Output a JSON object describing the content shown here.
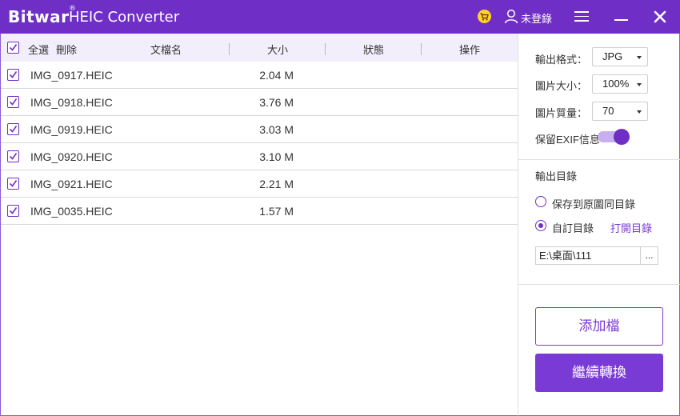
{
  "titlebar": {
    "logo": "Bitwar",
    "logo_mark": "®",
    "title": "HEIC Converter",
    "login_label": "未登錄",
    "icons": [
      "cart-icon",
      "user-icon",
      "menu-icon",
      "minimize-icon",
      "close-icon"
    ]
  },
  "table": {
    "select_all": "全選",
    "delete": "刪除",
    "headers": {
      "filename": "文檔名",
      "size": "大小",
      "status": "狀態",
      "action": "操作"
    },
    "rows": [
      {
        "name": "IMG_0917.HEIC",
        "size": "2.04 M",
        "checked": true
      },
      {
        "name": "IMG_0918.HEIC",
        "size": "3.76 M",
        "checked": true
      },
      {
        "name": "IMG_0919.HEIC",
        "size": "3.03 M",
        "checked": true
      },
      {
        "name": "IMG_0920.HEIC",
        "size": "3.10 M",
        "checked": true
      },
      {
        "name": "IMG_0921.HEIC",
        "size": "2.21 M",
        "checked": true
      },
      {
        "name": "IMG_0035.HEIC",
        "size": "1.57 M",
        "checked": true
      }
    ]
  },
  "settings": {
    "format_label": "輸出格式：",
    "format_value": "JPG",
    "size_label": "圖片大小：",
    "size_value": "100%",
    "quality_label": "圖片質量：",
    "quality_value": "70",
    "exif_label": "保留EXIF信息",
    "exif_on": true
  },
  "output": {
    "title": "輸出目錄",
    "option_same": "保存到原圖同目錄",
    "option_custom": "自訂目錄",
    "selected": "custom",
    "open_link": "打開目錄",
    "path": "E:\\桌面\\111",
    "browse": "..."
  },
  "buttons": {
    "add": "添加檔",
    "continue": "繼續轉換"
  },
  "colors": {
    "brand": "#6f2fc7",
    "accent": "#7a3ad6",
    "header_bg": "#f3eefb",
    "cart": "#ffd12a"
  }
}
